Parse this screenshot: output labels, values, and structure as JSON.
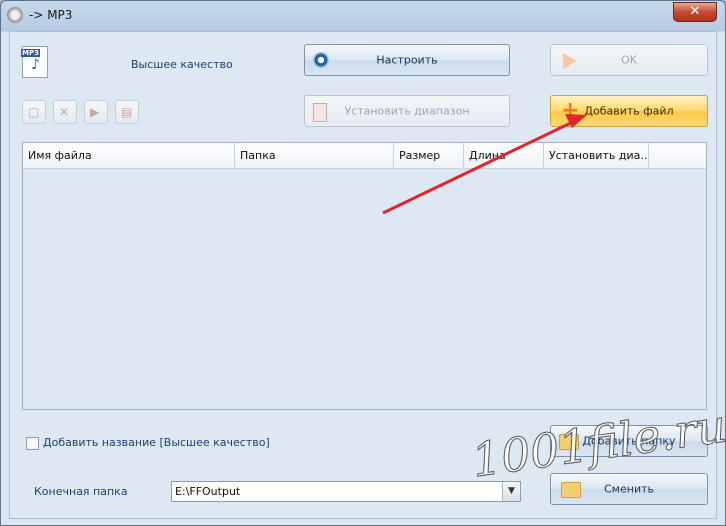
{
  "window": {
    "title": "-> MP3",
    "close_label": "✕"
  },
  "header": {
    "quality": "Высшее качество"
  },
  "buttons": {
    "configure": "Настроить",
    "ok": "OK",
    "set_range": "Установить диапазон",
    "add_file": "Добавить файл",
    "add_folder": "Добавить папку",
    "change": "Сменить"
  },
  "table": {
    "columns": [
      "Имя файла",
      "Папка",
      "Размер",
      "Длина",
      "Установить диа..."
    ]
  },
  "options": {
    "add_name": "Добавить название [Высшее качество]"
  },
  "destination": {
    "label": "Конечная папка",
    "value": "E:\\FFOutput"
  },
  "watermark": "1001file.ru",
  "colors": {
    "arrow": "#e0262a",
    "accent_button": "#ffd86c"
  }
}
